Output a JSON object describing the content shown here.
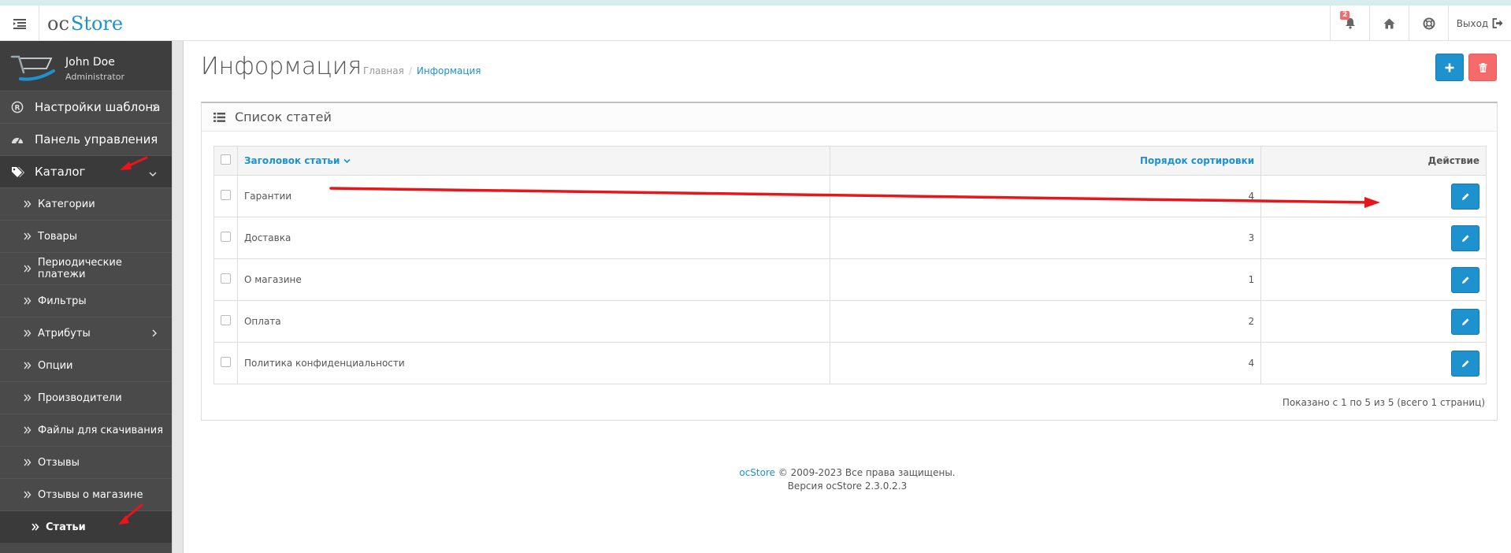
{
  "header": {
    "logo_part1": "oc",
    "logo_part2": "Store",
    "notification_count": "2",
    "logout_label": "Выход"
  },
  "profile": {
    "name": "John Doe",
    "role": "Administrator"
  },
  "sidebar": {
    "top_items": [
      {
        "label": "Настройки шаблона",
        "icon": "registered-icon"
      },
      {
        "label": "Панель управления",
        "icon": "dashboard-icon"
      },
      {
        "label": "Каталог",
        "icon": "tags-icon"
      }
    ],
    "catalog_items": [
      {
        "label": "Категории"
      },
      {
        "label": "Товары"
      },
      {
        "label": "Периодические платежи"
      },
      {
        "label": "Фильтры"
      },
      {
        "label": "Атрибуты"
      },
      {
        "label": "Опции"
      },
      {
        "label": "Производители"
      },
      {
        "label": "Файлы для скачивания"
      },
      {
        "label": "Отзывы"
      },
      {
        "label": "Отзывы о магазине"
      },
      {
        "label": "Статьи"
      }
    ]
  },
  "page": {
    "title": "Информация",
    "breadcrumb_home": "Главная",
    "breadcrumb_separator": "/",
    "breadcrumb_current": "Информация"
  },
  "panel": {
    "title": "Список статей",
    "columns": {
      "title": "Заголовок статьи",
      "sort_order": "Порядок сортировки",
      "action": "Действие"
    },
    "rows": [
      {
        "title": "Гарантии",
        "sort_order": "4"
      },
      {
        "title": "Доставка",
        "sort_order": "3"
      },
      {
        "title": "О магазине",
        "sort_order": "1"
      },
      {
        "title": "Оплата",
        "sort_order": "2"
      },
      {
        "title": "Политика конфиденциальности",
        "sort_order": "4"
      }
    ],
    "pagination": "Показано с 1 по 5 из 5 (всего 1 страниц)"
  },
  "footer": {
    "brand": "ocStore",
    "copyright": "© 2009-2023 Все права защищены.",
    "version": "Версия ocStore 2.3.0.2.3"
  },
  "colors": {
    "primary": "#1e91cf",
    "danger": "#f56b6b",
    "sidebar_bg": "#4a4a4a",
    "annotation": "#e8161a"
  }
}
